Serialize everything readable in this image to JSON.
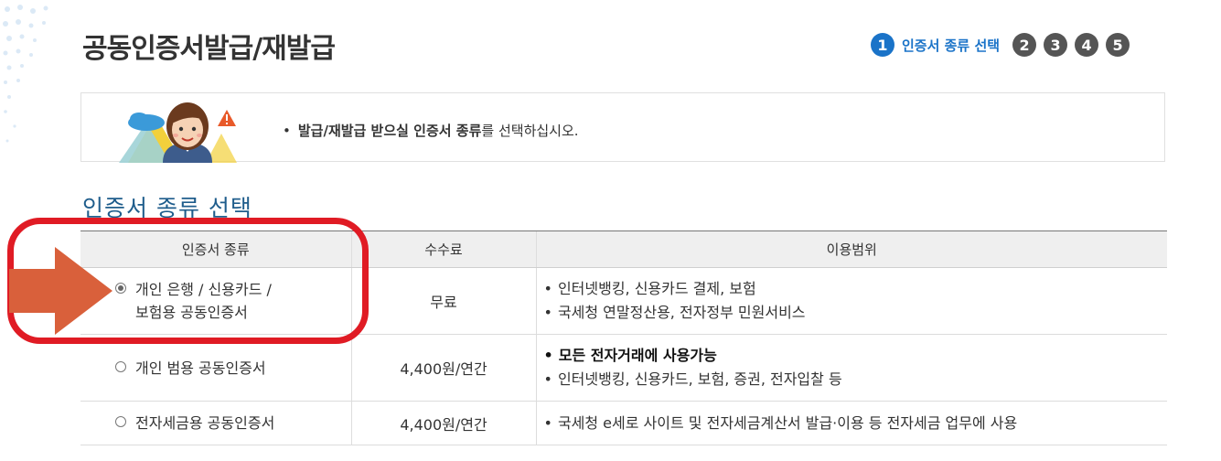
{
  "page": {
    "title": "공동인증서발급/재발급"
  },
  "steps": {
    "items": [
      "1",
      "2",
      "3",
      "4",
      "5"
    ],
    "current_label": "인증서 종류 선택",
    "active_color": "#1a73c8"
  },
  "notice": {
    "bullet": "•",
    "bold_text": "발급/재발급 받으실 인증서 종류",
    "normal_text": "를 선택하십시오."
  },
  "section": {
    "title": "인증서 종류 선택"
  },
  "table": {
    "headers": [
      "인증서 종류",
      "수수료",
      "이용범위"
    ],
    "rows": [
      {
        "type_line1": "개인 은행 / 신용카드 /",
        "type_line2": "보험용 공동인증서",
        "fee": "무료",
        "selected": true,
        "scope": [
          "인터넷뱅킹, 신용카드 결제, 보험",
          "국세청 연말정산용, 전자정부 민원서비스"
        ]
      },
      {
        "type_line1": "개인 범용 공동인증서",
        "fee": "4,400원/연간",
        "selected": false,
        "scope": [
          "모든 전자거래에 사용가능",
          "인터넷뱅킹, 신용카드, 보험, 증권, 전자입찰 등"
        ]
      },
      {
        "type_line1": "전자세금용 공동인증서",
        "fee": "4,400원/연간",
        "selected": false,
        "scope": [
          "국세청 e세로 사이트 및 전자세금계산서 발급·이용 등 전자세금 업무에 사용"
        ]
      }
    ]
  },
  "bullet": "•",
  "annotation_colors": {
    "highlight": "#e01b24",
    "arrow": "#d9603b"
  }
}
